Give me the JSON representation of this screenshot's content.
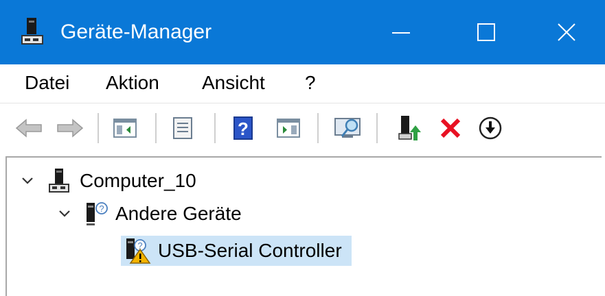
{
  "window": {
    "title": "Geräte-Manager",
    "icon": "device-manager-icon"
  },
  "menubar": {
    "items": [
      "Datei",
      "Aktion",
      "Ansicht",
      "?"
    ]
  },
  "toolbar": {
    "icons": [
      "back-arrow-icon",
      "forward-arrow-icon",
      "show-hide-console-tree-icon",
      "properties-icon",
      "help-icon",
      "action-pane-icon",
      "scan-hardware-icon",
      "update-driver-icon",
      "uninstall-device-icon",
      "disable-device-icon"
    ]
  },
  "tree": {
    "root": {
      "label": "Computer_10",
      "expanded": true
    },
    "category": {
      "label": "Andere Geräte",
      "expanded": true
    },
    "device": {
      "label": "USB-Serial Controller",
      "selected": true,
      "status": "warning"
    }
  },
  "colors": {
    "titlebar": "#0a78d7",
    "selection": "#cce4f7",
    "delete_red": "#e81123",
    "warning": "#f4b400"
  }
}
